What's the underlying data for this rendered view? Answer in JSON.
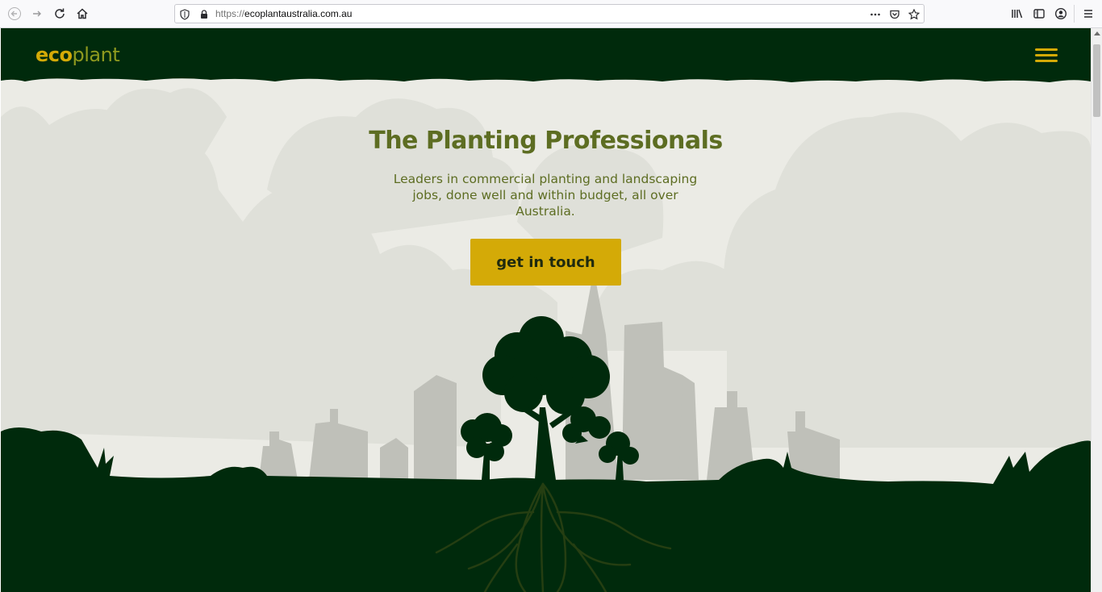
{
  "browser": {
    "url_prefix": "https://",
    "url_host": "ecoplantaustralia.com.au",
    "icons": [
      "back-icon",
      "forward-icon",
      "reload-icon",
      "home-icon",
      "shield-icon",
      "lock-icon",
      "more-icon",
      "pocket-icon",
      "bookmark-star-icon",
      "library-icon",
      "sidebar-icon",
      "account-icon",
      "menu-icon"
    ]
  },
  "site": {
    "logo_bold": "eco",
    "logo_light": "plant",
    "hero_title": "The Planting Professionals",
    "hero_subtitle": "Leaders in commercial planting and landscaping jobs, done well and within budget, all over Australia.",
    "cta_label": "get in touch"
  },
  "colors": {
    "dark_green": "#002a0c",
    "accent_gold": "#d4aa07",
    "olive_text": "#5d6d22",
    "background": "#ebebe5",
    "cloud": "#dfe0d9",
    "building": "#bfc0b9"
  }
}
